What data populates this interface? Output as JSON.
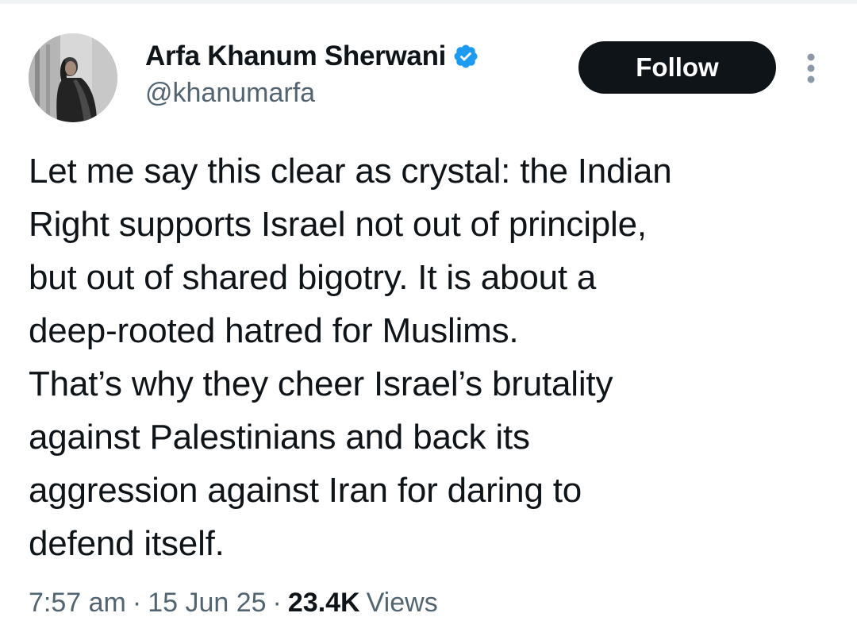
{
  "author": {
    "display_name": "Arfa Khanum Sherwani",
    "handle": "@khanumarfa",
    "verified": true,
    "verified_color": "#1d9bf0"
  },
  "actions": {
    "follow_label": "Follow",
    "more_icon": "more-vertical-icon"
  },
  "tweet": {
    "lines": [
      "Let me say this clear as crystal: the Indian",
      "Right supports Israel not out of principle,",
      "but out of shared bigotry. It is about a",
      "deep-rooted hatred for Muslims.",
      "That’s why they cheer Israel’s brutality",
      "against Palestinians and back its",
      "aggression against Iran for daring to",
      "defend itself."
    ]
  },
  "meta": {
    "time": "7:57 am",
    "separator": "·",
    "date": "15 Jun 25",
    "views_count": "23.4K",
    "views_label": "Views"
  },
  "colors": {
    "text_primary": "#0f1419",
    "text_secondary": "#536471",
    "button_bg": "#0f1419",
    "button_text": "#ffffff"
  }
}
